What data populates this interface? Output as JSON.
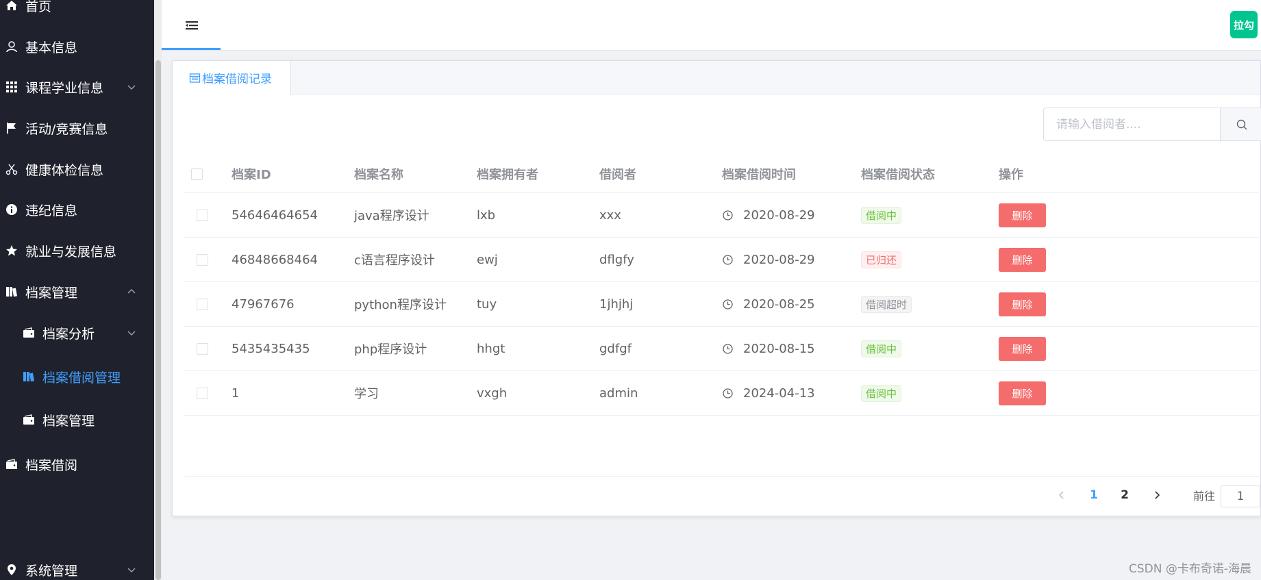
{
  "sidebar": {
    "items": [
      {
        "label": "首页",
        "icon": "home-icon"
      },
      {
        "label": "基本信息",
        "icon": "user-icon"
      },
      {
        "label": "课程学业信息",
        "icon": "grid-icon"
      },
      {
        "label": "活动/竞赛信息",
        "icon": "flag-icon"
      },
      {
        "label": "健康体检信息",
        "icon": "scissors-icon"
      },
      {
        "label": "违纪信息",
        "icon": "info-icon"
      },
      {
        "label": "就业与发展信息",
        "icon": "star-icon"
      },
      {
        "label": "档案管理",
        "icon": "archive-icon"
      },
      {
        "label": "档案分析",
        "icon": "wallet-icon"
      },
      {
        "label": "档案借阅管理",
        "icon": "archive-icon"
      },
      {
        "label": "档案管理",
        "icon": "wallet-icon"
      },
      {
        "label": "档案借阅",
        "icon": "wallet-icon"
      },
      {
        "label": "系统管理",
        "icon": "location-icon"
      }
    ]
  },
  "header": {
    "avatar_text": "拉勾"
  },
  "tabs": [
    {
      "label": "档案借阅记录"
    }
  ],
  "search": {
    "placeholder": "请输入借阅者....",
    "value": ""
  },
  "table": {
    "columns": [
      "档案ID",
      "档案名称",
      "档案拥有者",
      "借阅者",
      "档案借阅时间",
      "档案借阅状态",
      "操作"
    ],
    "rows": [
      {
        "id": "54646464654",
        "name": "java程序设计",
        "owner": "lxb",
        "borrower": "xxx",
        "time": "2020-08-29",
        "status": "借阅中",
        "status_color": "green",
        "action": "删除"
      },
      {
        "id": "46848668464",
        "name": "c语言程序设计",
        "owner": "ewj",
        "borrower": "dflgfy",
        "time": "2020-08-29",
        "status": "已归还",
        "status_color": "red",
        "action": "删除"
      },
      {
        "id": "47967676",
        "name": "python程序设计",
        "owner": "tuy",
        "borrower": "1jhjhj",
        "time": "2020-08-25",
        "status": "借阅超时",
        "status_color": "gray",
        "action": "删除"
      },
      {
        "id": "5435435435",
        "name": "php程序设计",
        "owner": "hhgt",
        "borrower": "gdfgf",
        "time": "2020-08-15",
        "status": "借阅中",
        "status_color": "green",
        "action": "删除"
      },
      {
        "id": "1",
        "name": "学习",
        "owner": "vxgh",
        "borrower": "admin",
        "time": "2024-04-13",
        "status": "借阅中",
        "status_color": "green",
        "action": "删除"
      }
    ]
  },
  "pagination": {
    "pages": [
      "1",
      "2"
    ],
    "current": "1",
    "goto_label": "前往",
    "goto_value": "1"
  },
  "watermark": "CSDN @卡布奇诺-海晨",
  "colors": {
    "sidebar_bg": "#1f222c",
    "accent": "#409eff",
    "danger": "#f56c6c",
    "success": "#67c23a",
    "avatar": "#00c58e"
  }
}
